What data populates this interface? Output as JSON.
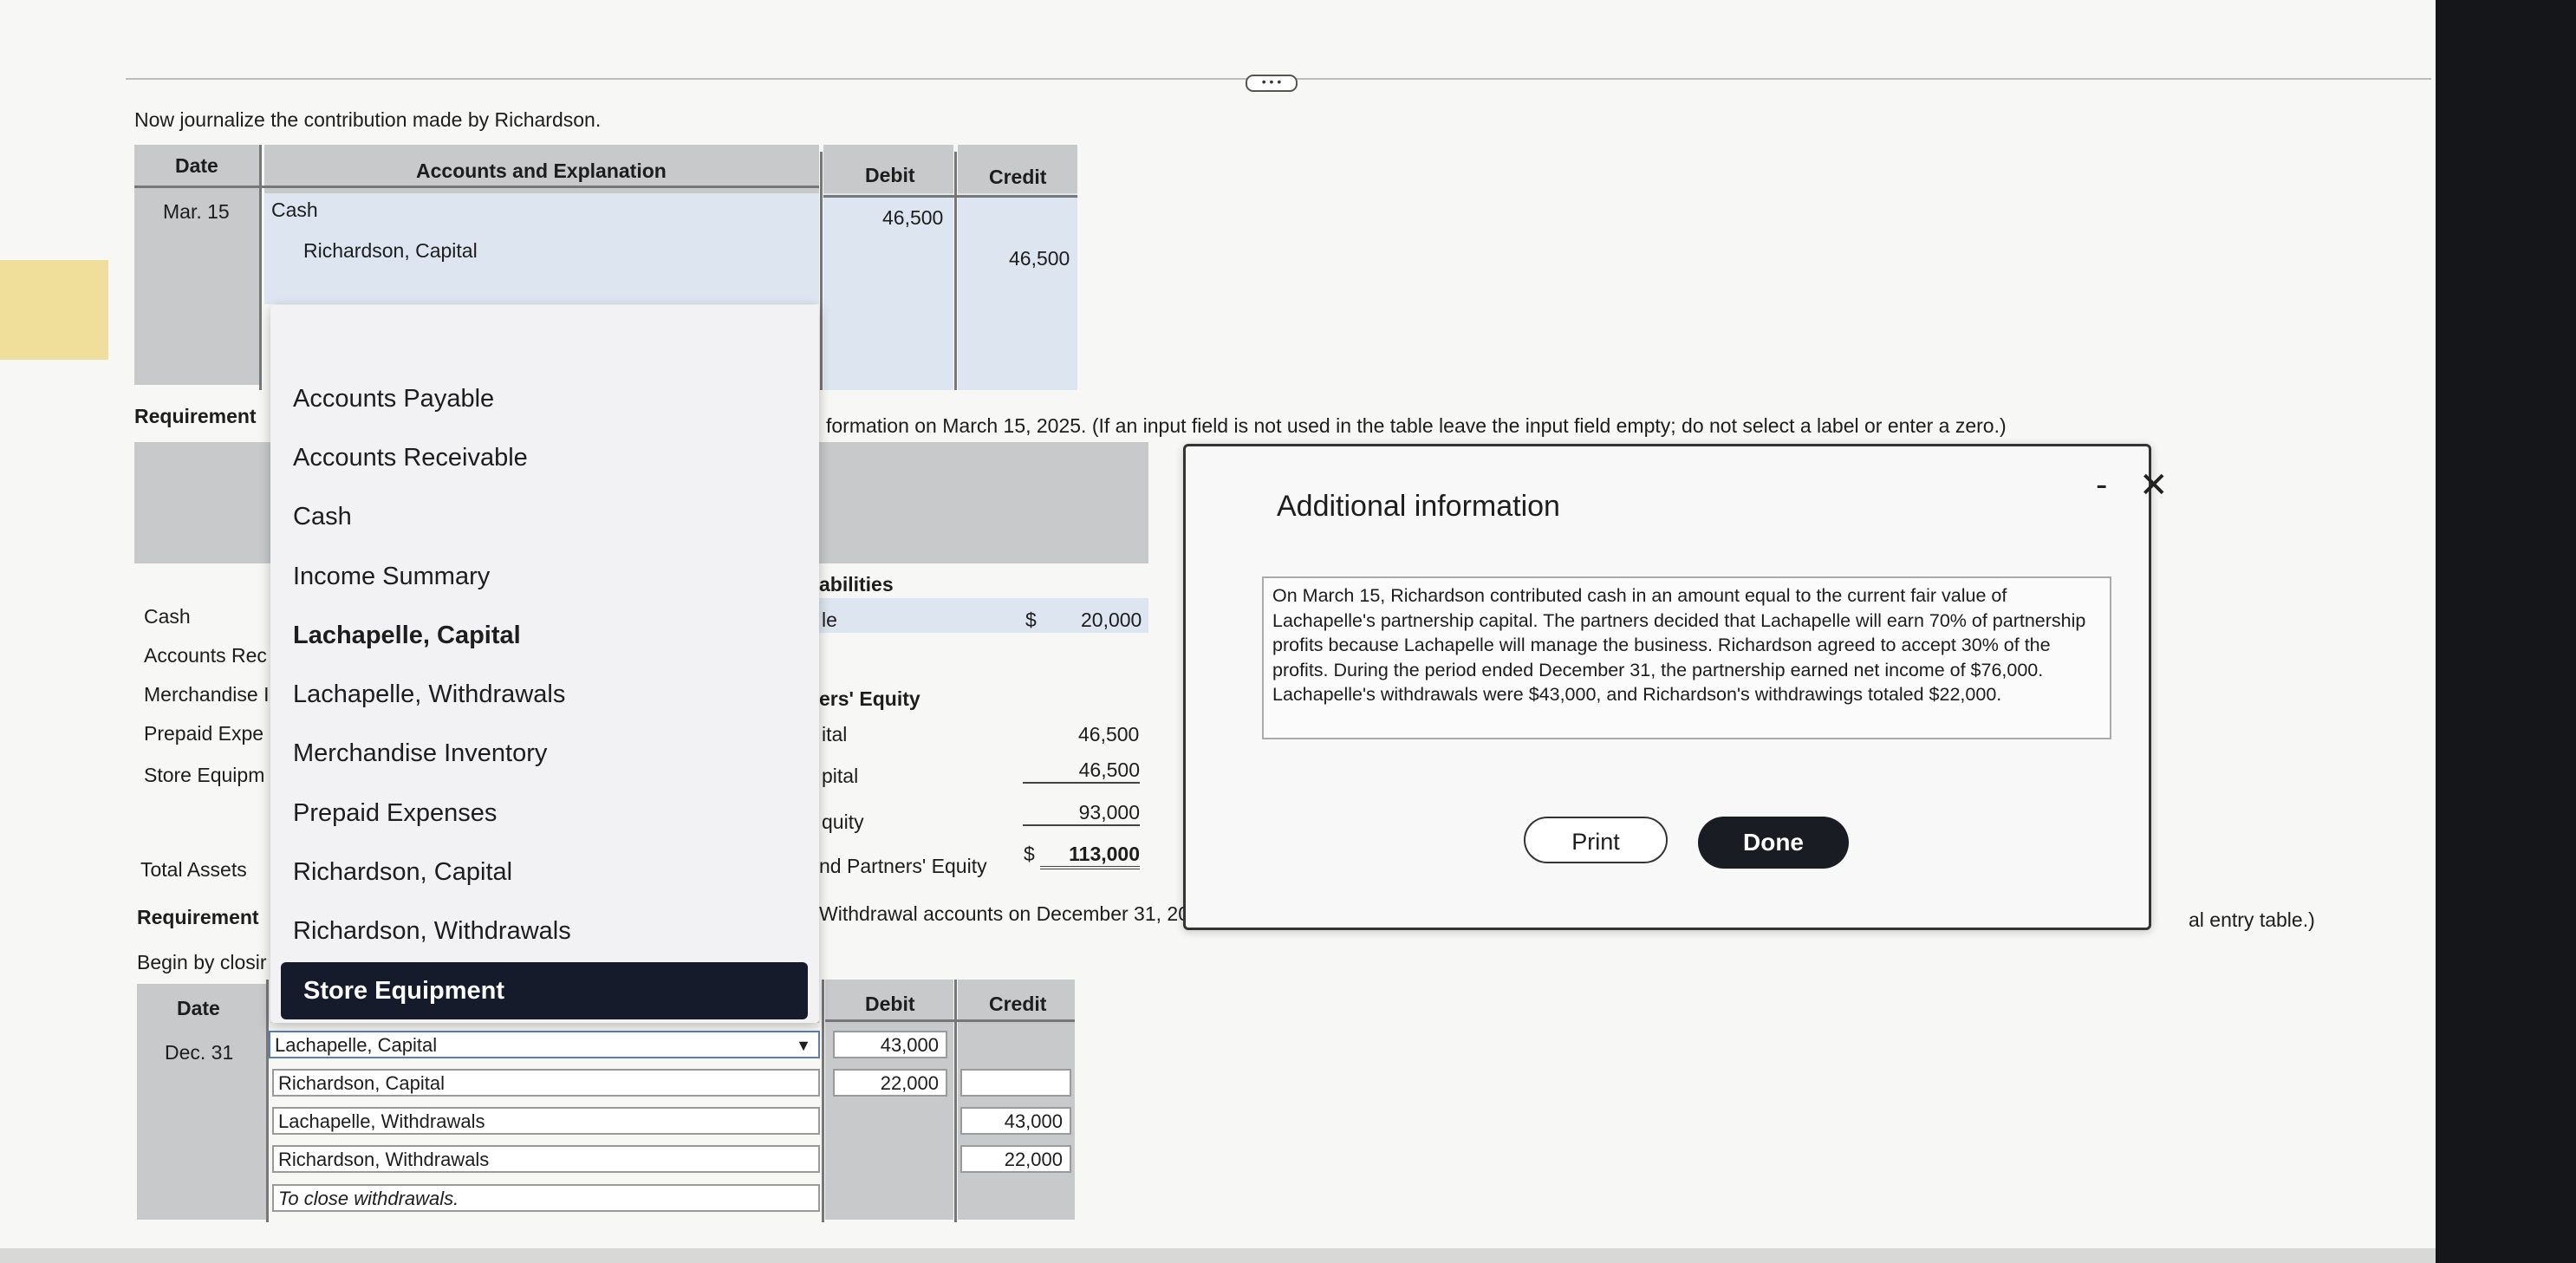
{
  "journal1": {
    "instruction": "Now journalize the contribution made by Richardson.",
    "headers": {
      "date": "Date",
      "accounts": "Accounts and Explanation",
      "debit": "Debit",
      "credit": "Credit"
    },
    "date": "Mar. 15",
    "row1_account": "Cash",
    "row1_debit": "46,500",
    "row2_account": "Richardson, Capital",
    "row2_credit": "46,500"
  },
  "requirement2": {
    "label": "Requirement",
    "instruction_visible": "formation on March 15, 2025. (If an input field is not used in the table leave the input field empty; do not select a label or enter a zero.)"
  },
  "balance_sheet": {
    "left_labels": [
      "Cash",
      "Accounts Rec",
      "Merchandise I",
      "Prepaid Expe",
      "Store Equipm"
    ],
    "total_assets": "Total Assets",
    "liabilities_header": "abilities",
    "payable_label": "le",
    "payable_dollar": "$",
    "payable_value": "20,000",
    "equity_header": "ers' Equity",
    "capital1_label": "ital",
    "capital1_value": "46,500",
    "capital2_label": "pital",
    "capital2_value": "46,500",
    "equity_label": "quity",
    "equity_value": "93,000",
    "total_label": "nd Partners' Equity",
    "total_dollar": "$",
    "total_value": "113,000"
  },
  "requirement3": {
    "label": "Requirement",
    "instruction_visible": "Withdrawal accounts on December 31, 20",
    "begin": "Begin by closir",
    "trailing": "al entry table.)"
  },
  "journal2": {
    "headers": {
      "date": "Date",
      "debit": "Debit",
      "credit": "Credit"
    },
    "date": "Dec. 31",
    "rows": [
      {
        "account": "Lachapelle, Capital",
        "debit": "43,000",
        "credit": ""
      },
      {
        "account": "Richardson, Capital",
        "debit": "22,000",
        "credit": ""
      },
      {
        "account": "Lachapelle, Withdrawals",
        "debit": "",
        "credit": "43,000"
      },
      {
        "account": "Richardson, Withdrawals",
        "debit": "",
        "credit": "22,000"
      }
    ],
    "explanation": "To close withdrawals."
  },
  "dropdown": {
    "items": [
      "Accounts Payable",
      "Accounts Receivable",
      "Cash",
      "Income Summary",
      "Lachapelle, Capital",
      "Lachapelle, Withdrawals",
      "Merchandise Inventory",
      "Prepaid Expenses",
      "Richardson, Capital",
      "Richardson, Withdrawals"
    ],
    "selected": "Store Equipment",
    "caret": "▼"
  },
  "modal": {
    "title": "Additional information",
    "body": "On March 15, Richardson contributed cash in an amount equal to the current fair value of Lachapelle's partnership capital. The partners decided that Lachapelle will earn 70% of partnership profits because Lachapelle will manage the business. Richardson agreed to accept 30% of the profits. During the period ended December 31, the partnership earned net income of $76,000. Lachapelle's withdrawals were $43,000, and Richardson's withdrawings totaled $22,000.",
    "print_label": "Print",
    "done_label": "Done",
    "close_glyph": "✕",
    "minimize_glyph": "-"
  },
  "toolbar": {
    "more_glyph": "• • •"
  }
}
